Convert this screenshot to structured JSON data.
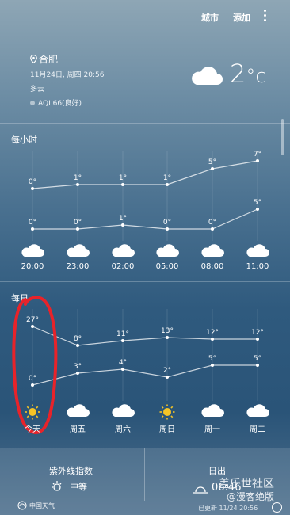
{
  "topbar": {
    "city_label": "城市",
    "add_label": "添加"
  },
  "location": {
    "city": "合肥",
    "datetime": "11月24日, 周四 20:56",
    "condition": "多云",
    "aqi": "AQI 66(良好)"
  },
  "current": {
    "temperature": "2",
    "unit": "°c",
    "icon": "cloud-icon"
  },
  "hourly": {
    "title": "每小时",
    "times": [
      "20:00",
      "23:00",
      "02:00",
      "05:00",
      "08:00",
      "11:00"
    ],
    "high": [
      "0°",
      "1°",
      "1°",
      "1°",
      "5°",
      "7°"
    ],
    "low": [
      "0°",
      "0°",
      "1°",
      "0°",
      "0°",
      "5°"
    ],
    "high_values": [
      0,
      1,
      1,
      1,
      5,
      7
    ],
    "low_values": [
      0,
      0,
      1,
      0,
      0,
      5
    ],
    "icons": [
      "cloud-icon",
      "cloud-icon",
      "cloud-icon",
      "cloud-icon",
      "cloud-icon",
      "cloud-icon"
    ]
  },
  "daily": {
    "title": "每日",
    "days": [
      "今天",
      "周五",
      "周六",
      "周日",
      "周一",
      "周二"
    ],
    "high": [
      "27°",
      "8°",
      "11°",
      "13°",
      "12°",
      "12°"
    ],
    "low": [
      "0°",
      "3°",
      "4°",
      "2°",
      "5°",
      "5°"
    ],
    "high_values": [
      27,
      8,
      11,
      13,
      12,
      12
    ],
    "low_values": [
      0,
      3,
      4,
      2,
      5,
      5
    ],
    "icons": [
      "sun-icon",
      "cloud-icon",
      "cloud-icon",
      "sun-icon",
      "cloud-icon",
      "cloud-icon"
    ]
  },
  "details": {
    "uv_title": "紫外线指数",
    "uv_value": "中等",
    "sunrise_title": "日出",
    "sunrise_value": "06:46"
  },
  "footer": {
    "logo": "中国天气",
    "updated": "已更新 11/24 20:56"
  },
  "watermark": {
    "line1": "盖乐世社区",
    "line2": "@漫客绝版"
  },
  "colors": {
    "annotation": "#e8232a"
  }
}
